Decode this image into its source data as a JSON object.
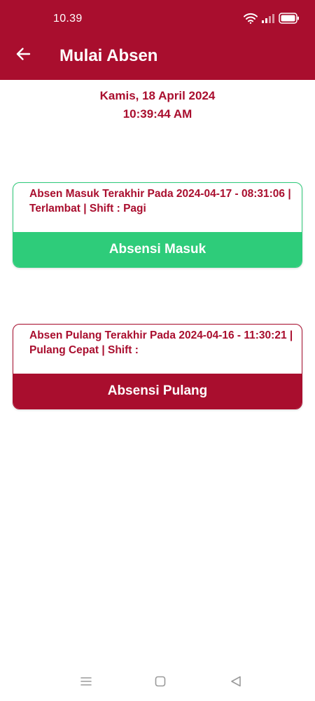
{
  "status_bar": {
    "time": "10.39"
  },
  "header": {
    "title": "Mulai Absen",
    "background": "#A90E2E"
  },
  "datetime": {
    "date": "Kamis, 18 April 2024",
    "time": "10:39:44 AM"
  },
  "masuk_card": {
    "info": "Absen Masuk Terakhir Pada 2024-04-17 - 08:31:06 | Terlambat | Shift : Pagi",
    "button_label": "Absensi Masuk",
    "accent": "#2ECC7A"
  },
  "pulang_card": {
    "info": "Absen Pulang Terakhir Pada 2024-04-16 - 11:30:21 | Pulang Cepat | Shift :",
    "button_label": "Absensi Pulang",
    "accent": "#A90E2E"
  },
  "icons": {
    "back": "arrow-left-icon",
    "wifi": "wifi-icon",
    "signal": "signal-icon",
    "battery": "battery-icon",
    "nav_menu": "menu-icon",
    "nav_home": "home-square-icon",
    "nav_back": "back-triangle-icon"
  }
}
